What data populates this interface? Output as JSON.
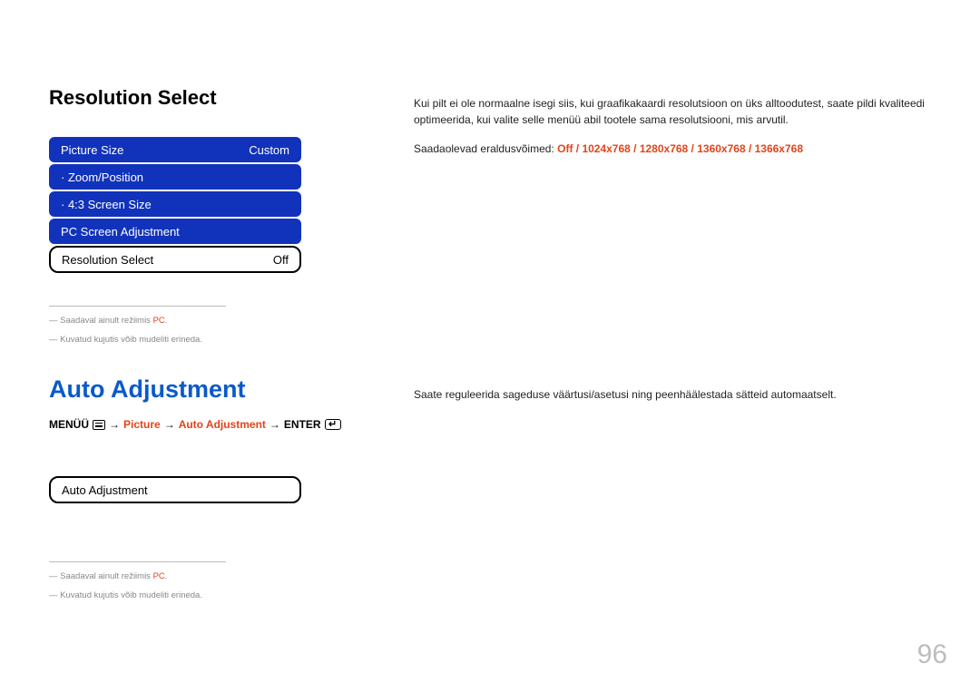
{
  "section1": {
    "title": "Resolution Select",
    "desc1": "Kui pilt ei ole normaalne isegi siis, kui graafikakaardi resolutsioon on üks alltoodutest, saate pildi kvaliteedi optimeerida, kui valite selle menüü abil tootele sama resolutsiooni, mis arvutil.",
    "desc2_prefix": "Saadaolevad eraldusvõimed: ",
    "desc2_values": "Off / 1024x768 / 1280x768 / 1360x768 / 1366x768",
    "menu": {
      "row1_label": "Picture Size",
      "row1_value": "Custom",
      "row2_label": "· Zoom/Position",
      "row3_label": "· 4:3 Screen Size",
      "row4_label": "PC Screen Adjustment",
      "row5_label": "Resolution Select",
      "row5_value": "Off"
    },
    "footnote1_prefix": "―  Saadaval ainult režiimis ",
    "footnote1_red": "PC",
    "footnote1_suffix": ".",
    "footnote2": "―  Kuvatud kujutis võib mudeliti erineda."
  },
  "section2": {
    "title": "Auto Adjustment",
    "desc": "Saate reguleerida sageduse väärtusi/asetusi ning peenhäälestada sätteid automaatselt.",
    "crumb_menu": "MENÜÜ",
    "crumb_arrow": "→",
    "crumb_picture": "Picture",
    "crumb_auto": "Auto Adjustment",
    "crumb_enter": "ENTER",
    "menu_label": "Auto Adjustment",
    "footnote1_prefix": "―  Saadaval ainult režiimis ",
    "footnote1_red": "PC",
    "footnote1_suffix": ".",
    "footnote2": "―  Kuvatud kujutis võib mudeliti erineda."
  },
  "pagenum": "96"
}
